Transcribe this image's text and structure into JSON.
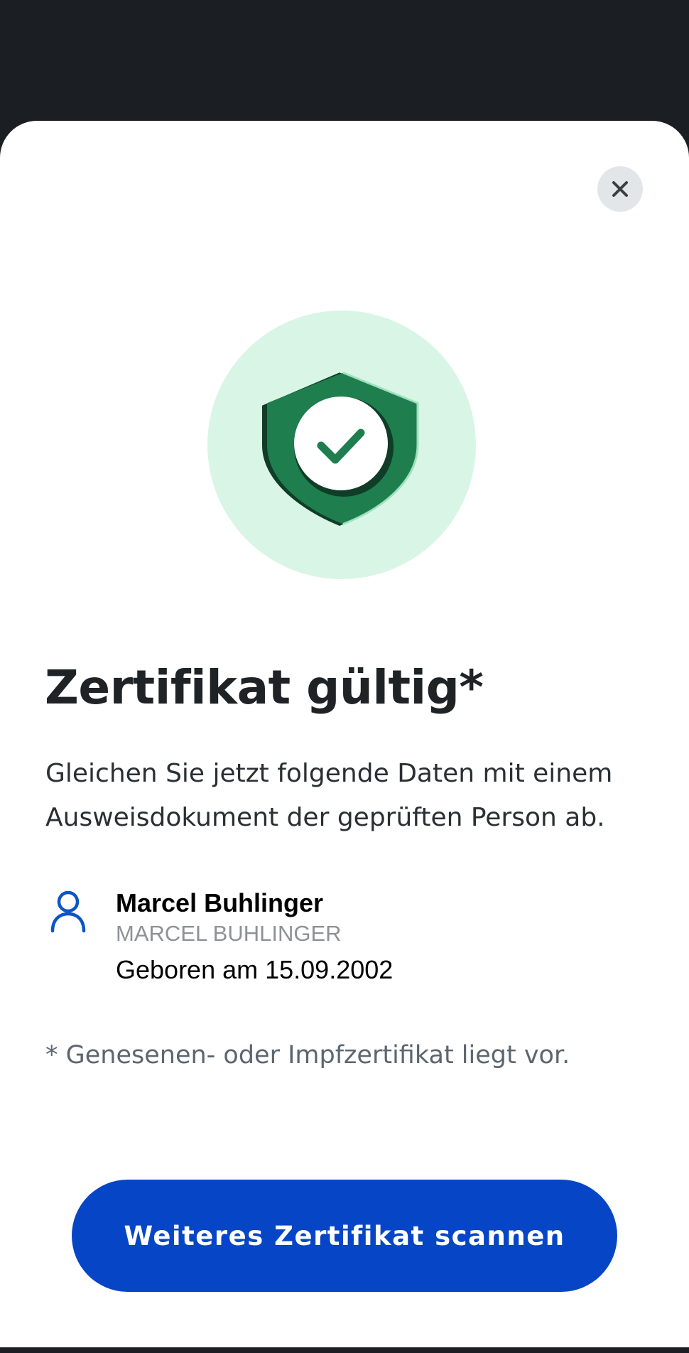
{
  "dialog": {
    "close_icon": "close-icon",
    "status_icon": "shield-check-icon",
    "title": "Zertifikat gültig*",
    "intro": "Gleichen Sie jetzt folgende Daten mit einem Ausweisdokument der geprüften Person ab.",
    "person": {
      "icon": "person-icon",
      "name": "Marcel Buhlinger",
      "name_uppercase": "MARCEL BUHLINGER",
      "birth_date": "Geboren am 15.09.2002"
    },
    "footnote": "* Genesenen- oder Impfzertifikat liegt vor.",
    "scan_button_label": "Weiteres Zertifikat scannen"
  },
  "colors": {
    "background_dark": "#1b1f24",
    "sheet": "#ffffff",
    "hero_circle": "#d9f5e6",
    "shield_green": "#1e7e4e",
    "shield_dark": "#0f3d27",
    "primary_button": "#0646c6",
    "person_icon": "#0b55c4",
    "footnote_text": "#5b6670",
    "secondary_text": "#8e9296"
  }
}
